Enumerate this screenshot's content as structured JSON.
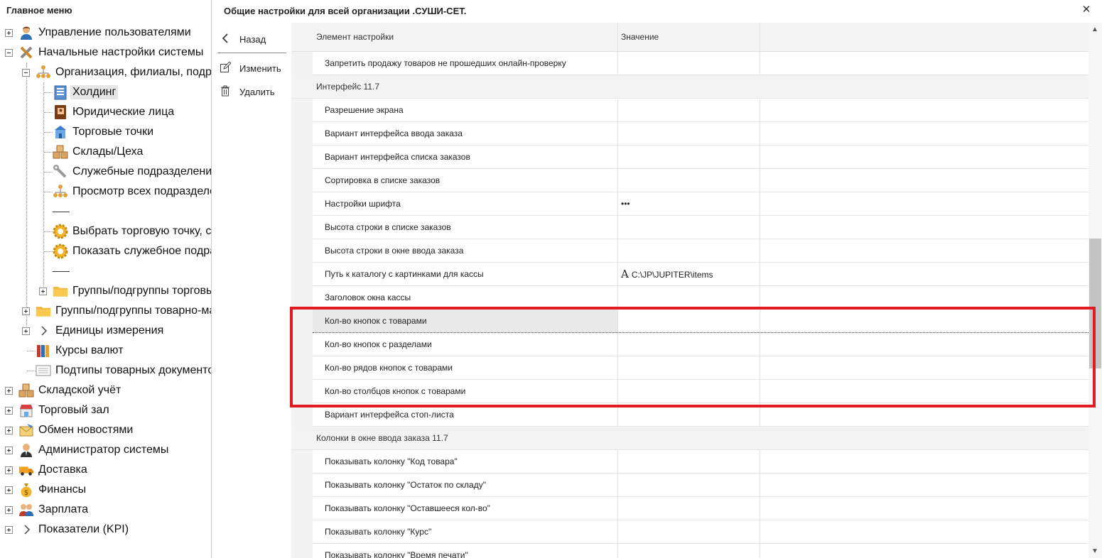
{
  "left_panel": {
    "title": "Главное меню",
    "items": [
      {
        "label": "Управление пользователями",
        "icon": "user-icon"
      },
      {
        "label": "Начальные настройки системы",
        "icon": "tools-icon"
      },
      {
        "label": "Организация, филиалы, подразделения",
        "icon": "org-chart-icon"
      },
      {
        "label": "Холдинг",
        "icon": "building-icon"
      },
      {
        "label": "Юридические лица",
        "icon": "book-icon"
      },
      {
        "label": "Торговые точки",
        "icon": "shop-icon"
      },
      {
        "label": "Склады/Цеха",
        "icon": "boxes-icon"
      },
      {
        "label": "Служебные подразделения",
        "icon": "wrench-icon"
      },
      {
        "label": "Просмотр всех подразделений",
        "icon": "org-chart-icon"
      },
      {
        "label": "Выбрать торговую точку, смену",
        "icon": "gear-icon"
      },
      {
        "label": "Показать служебное подразделение",
        "icon": "gear-icon"
      },
      {
        "label": "Группы/подгруппы торговых точек",
        "icon": "folder-icon"
      },
      {
        "label": "Группы/подгруппы товарно-материальных ценностей",
        "icon": "folder-icon"
      },
      {
        "label": "Единицы измерения",
        "icon": "chevron-right-icon"
      },
      {
        "label": "Курсы валют",
        "icon": "binders-icon"
      },
      {
        "label": "Подтипы товарных документов",
        "icon": "list-icon"
      },
      {
        "label": "Складской учёт",
        "icon": "boxes-icon"
      },
      {
        "label": "Торговый зал",
        "icon": "store-icon"
      },
      {
        "label": "Обмен новостями",
        "icon": "envelope-icon"
      },
      {
        "label": "Администратор системы",
        "icon": "admin-icon"
      },
      {
        "label": "Доставка",
        "icon": "truck-icon"
      },
      {
        "label": "Финансы",
        "icon": "money-bag-icon"
      },
      {
        "label": "Зарплата",
        "icon": "people-icon"
      },
      {
        "label": "Показатели (KPI)",
        "icon": "chevron-right-icon"
      }
    ]
  },
  "dialog": {
    "title": "Общие настройки для всей организации .СУШИ-СЕТ.",
    "close_icon": "✕",
    "actions": {
      "back": "Назад",
      "edit": "Изменить",
      "delete": "Удалить"
    },
    "columns": {
      "element": "Элемент настройки",
      "value": "Значение"
    },
    "rows": [
      {
        "label": "Запретить продажу товаров не прошедших онлайн-проверку",
        "value": ""
      },
      {
        "label": "Интерфейс 11.7",
        "value": "",
        "group": true
      },
      {
        "label": "Разрешение экрана",
        "value": ""
      },
      {
        "label": "Вариант интерфейса ввода заказа",
        "value": ""
      },
      {
        "label": "Вариант интерфейса списка заказов",
        "value": ""
      },
      {
        "label": "Сортировка в списке заказов",
        "value": ""
      },
      {
        "label": "Настройки шрифта",
        "value": "•••"
      },
      {
        "label": "Высота строки в списке заказов",
        "value": ""
      },
      {
        "label": "Высота строки в окне ввода заказа",
        "value": ""
      },
      {
        "label": "Путь к каталогу с картинками для кассы",
        "value": "C:\\JP\\JUPITER\\items"
      },
      {
        "label": "Заголовок окна кассы",
        "value": ""
      },
      {
        "label": "Кол-во кнопок с товарами",
        "value": ""
      },
      {
        "label": "Кол-во кнопок с разделами",
        "value": ""
      },
      {
        "label": "Кол-во рядов кнопок с товарами",
        "value": ""
      },
      {
        "label": "Кол-во столбцов кнопок с товарами",
        "value": ""
      },
      {
        "label": "Вариант интерфейса стоп-листа",
        "value": ""
      },
      {
        "label": "Колонки в окне ввода заказа 11.7",
        "value": "",
        "group": true
      },
      {
        "label": "Показывать колонку \"Код товара\"",
        "value": ""
      },
      {
        "label": "Показывать колонку \"Остаток по складу\"",
        "value": ""
      },
      {
        "label": "Показывать колонку \"Оставшееся кол-во\"",
        "value": ""
      },
      {
        "label": "Показывать колонку \"Курс\"",
        "value": ""
      },
      {
        "label": "Показывать колонку \"Время печати\"",
        "value": ""
      }
    ]
  },
  "colors": {
    "highlight": "#e01b24",
    "selection": "#e6e6e6",
    "group_row": "#f3f3f3"
  }
}
